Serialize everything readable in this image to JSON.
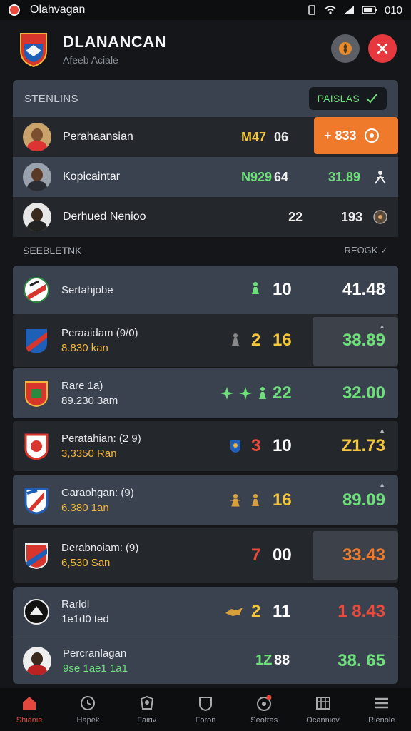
{
  "status_bar": {
    "title": "Olahvagan",
    "time": "010"
  },
  "header": {
    "title": "DLANANCAN",
    "subtitle": "Afeeb Aciale"
  },
  "standings": {
    "heading": "STENLINS",
    "pill_label": "PAISLAS",
    "rows": [
      {
        "name": "Perahaansian",
        "stat1": "M47",
        "stat2": "06",
        "value": "+ 833",
        "value_color": "#ffffff",
        "stat1_color": "#f2c53a",
        "highlight": true
      },
      {
        "name": "Kopicaintar",
        "stat1": "N929",
        "stat2": "64",
        "value": "31.89",
        "value_color": "#6ee07a",
        "stat1_color": "#6ee07a"
      },
      {
        "name": "Derhued Nenioo",
        "stat1": "",
        "stat2": "22",
        "value": "193",
        "value_color": "#eeeeee",
        "stat1_color": "#eeeeee"
      }
    ]
  },
  "selection": {
    "heading": "SEEBLETNK",
    "right_label": "REOGK",
    "cards": [
      {
        "line1": "Sertahjobe",
        "line2": "",
        "num1": "",
        "num2": "10",
        "score": "41.48",
        "num1_color": "#6ee07a",
        "score_color": "#ffffff"
      },
      {
        "line1": "Peraaidam (9/0)",
        "line2": "8.830 kan",
        "num1": "2",
        "num2": "16",
        "score": "38.89",
        "num1_color": "#f2c53a",
        "num2_color": "#f2c53a",
        "score_color": "#6ee07a"
      },
      {
        "line1": "Rare 1a)",
        "line2": "89.230 3am",
        "num1": "",
        "num2": "22",
        "score": "32.00",
        "num1_color": "#6ee07a",
        "num2_color": "#6ee07a",
        "score_color": "#6ee07a"
      },
      {
        "line1": "Peratahian: (2 9)",
        "line2": "3,3350 Ran",
        "num1": "3",
        "num2": "10",
        "score": "Z1.73",
        "num1_color": "#e84a3c",
        "num2_color": "#ffffff",
        "score_color": "#f2c53a"
      },
      {
        "line1": "Garaohgan: (9)",
        "line2": "6.380 1an",
        "num1": "",
        "num2": "16",
        "score": "89.09",
        "num1_color": "#f2c53a",
        "num2_color": "#f2c53a",
        "score_color": "#6ee07a"
      },
      {
        "line1": "Derabnoiam: (9)",
        "line2": "6,530 San",
        "num1": "7",
        "num2": "00",
        "score": "33.43",
        "num1_color": "#e84a3c",
        "num2_color": "#ffffff",
        "score_color": "#f07a2c"
      },
      {
        "line1": "Rarldl",
        "line2": "1e1d0 ted",
        "num1": "2",
        "num2": "11",
        "score": "1 8.43",
        "num1_color": "#f2c53a",
        "num2_color": "#ffffff",
        "score_color": "#e84a3c"
      },
      {
        "line1": "Percranlagan",
        "line2": "9se 1ae1 1a1",
        "num1": "1Z",
        "num2": "88",
        "score": "38. 65",
        "num1_color": "#6ee07a",
        "num2_color": "#ffffff",
        "score_color": "#6ee07a"
      }
    ]
  },
  "tabbar": {
    "tabs": [
      {
        "label": "Shianie",
        "icon": "home-icon"
      },
      {
        "label": "Hapek",
        "icon": "clock-icon"
      },
      {
        "label": "Fairiv",
        "icon": "team-icon"
      },
      {
        "label": "Foron",
        "icon": "shield-icon"
      },
      {
        "label": "Seotras",
        "icon": "ball-icon"
      },
      {
        "label": "Ocanniov",
        "icon": "grid-icon"
      },
      {
        "label": "Rienole",
        "icon": "menu-icon"
      }
    ]
  }
}
